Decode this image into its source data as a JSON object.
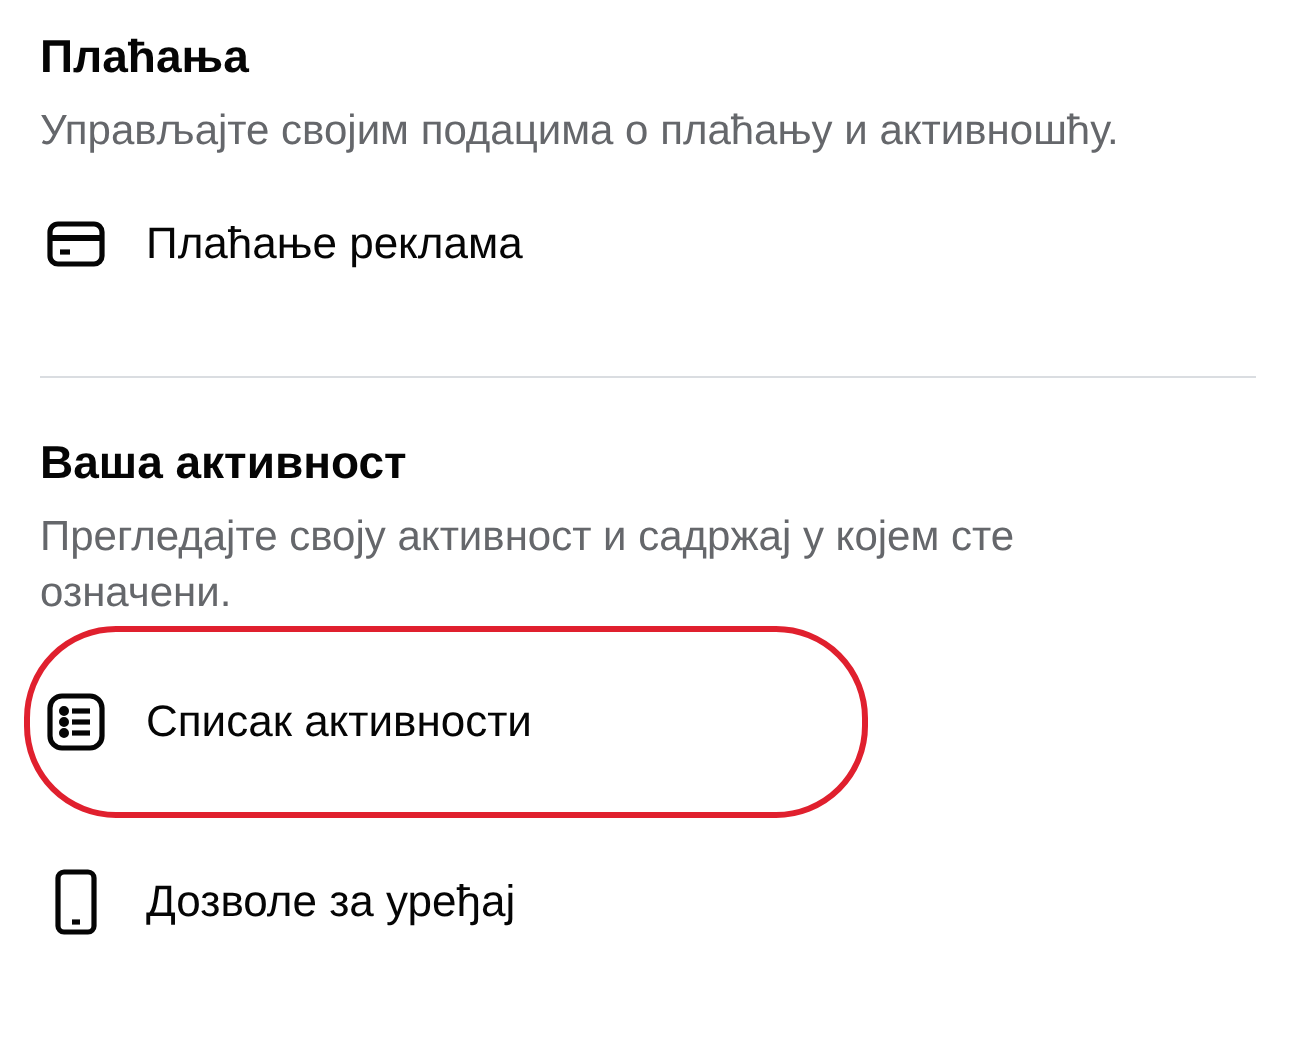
{
  "sections": [
    {
      "title": "Плаћања",
      "description": "Управљајте својим подацима о плаћању и активношћу.",
      "items": [
        {
          "kind": "card",
          "label": "Плаћање реклама",
          "highlighted": false
        }
      ]
    },
    {
      "title": "Ваша активност",
      "description": "Прегледајте своју активност и садржај у којем сте означени.",
      "items": [
        {
          "kind": "list",
          "label": "Списак активности",
          "highlighted": true
        },
        {
          "kind": "phone",
          "label": "Дозволе за уређај",
          "highlighted": false
        }
      ]
    }
  ]
}
